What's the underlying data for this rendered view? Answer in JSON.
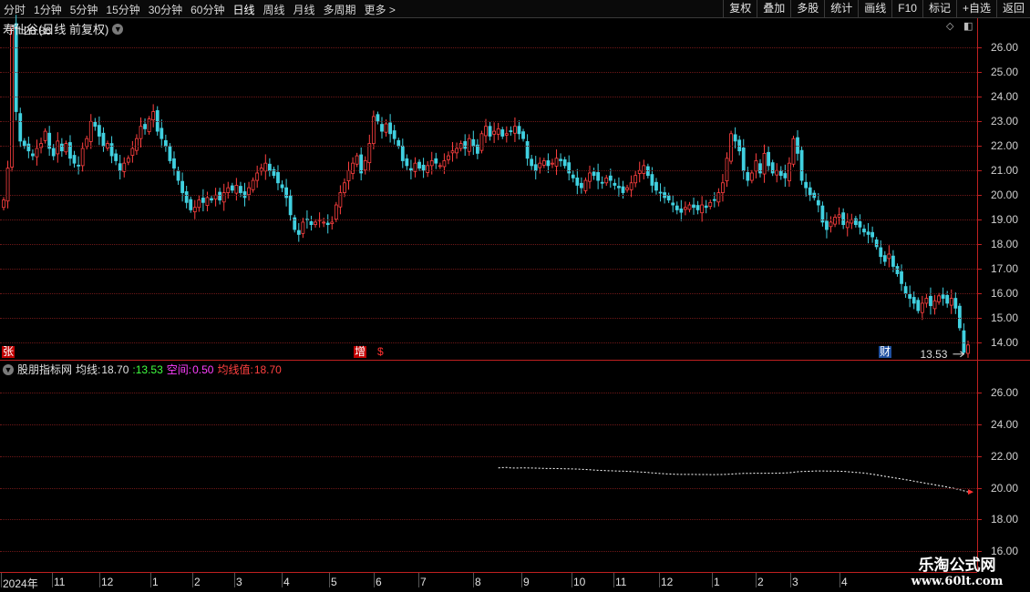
{
  "toolbar": {
    "periods": [
      "分时",
      "1分钟",
      "5分钟",
      "15分钟",
      "30分钟",
      "60分钟",
      "日线",
      "周线",
      "月线",
      "多周期",
      "更多 >"
    ],
    "active_period": "日线",
    "tools": [
      "复权",
      "叠加",
      "多股",
      "统计",
      "画线",
      "F10",
      "标记",
      "+自选",
      "返回"
    ]
  },
  "main": {
    "stock_name": "寿仙谷",
    "chart_mode": "(日线 前复权)",
    "high_label": "26.86",
    "low_label": "13.53",
    "y_ticks": [
      "26.00",
      "25.00",
      "24.00",
      "23.00",
      "22.00",
      "21.00",
      "20.00",
      "19.00",
      "18.00",
      "17.00",
      "16.00",
      "15.00",
      "14.00"
    ],
    "markers": {
      "zhang": "张",
      "zeng": "增",
      "dollar": "$",
      "cai": "财"
    },
    "colors": {
      "up": "#ff4040",
      "down": "#40d0e0",
      "grid": "#6e1818",
      "axis": "#c02020"
    }
  },
  "indicator": {
    "name": "股朋指标网",
    "label1": "均线:",
    "value1": "18.70",
    "label2": ":13.53",
    "label3": "空间:",
    "value3": "0.50",
    "label4": "均线值:",
    "value4": "18.70",
    "y_ticks": [
      "26.00",
      "24.00",
      "22.00",
      "20.00",
      "18.00",
      "16.00"
    ],
    "colors": {
      "name": "#e0e0e0",
      "value2": "#40ff40",
      "value3": "#ff40ff",
      "value4": "#ff4040"
    }
  },
  "dates": [
    "2024年",
    "11",
    "12",
    "1",
    "2",
    "3",
    "4",
    "5",
    "6",
    "7",
    "8",
    "9",
    "10",
    "11",
    "12",
    "1",
    "2",
    "3",
    "4"
  ],
  "watermark": {
    "name": "乐淘公式网",
    "url": "www.60lt.com"
  },
  "chart_data": {
    "type": "candlestick",
    "ylim": [
      13.3,
      27.2
    ],
    "closes": [
      19.8,
      21.1,
      26.86,
      23.4,
      22.2,
      22.0,
      21.8,
      21.6,
      21.9,
      22.1,
      22.6,
      21.9,
      21.6,
      22.2,
      21.8,
      22.1,
      21.5,
      21.3,
      21.2,
      21.9,
      22.3,
      23.0,
      22.8,
      22.4,
      22.0,
      22.1,
      21.6,
      21.4,
      21.0,
      21.3,
      21.5,
      21.9,
      22.3,
      22.8,
      22.7,
      23.1,
      23.4,
      22.6,
      22.3,
      22.0,
      21.4,
      21.1,
      20.6,
      20.1,
      19.7,
      19.4,
      19.5,
      19.8,
      19.7,
      19.9,
      19.8,
      20.0,
      19.8,
      20.1,
      20.3,
      20.2,
      20.4,
      20.1,
      19.9,
      20.3,
      20.6,
      20.9,
      21.1,
      21.3,
      21.0,
      20.8,
      20.5,
      20.3,
      19.9,
      19.2,
      18.6,
      18.4,
      18.9,
      19.0,
      18.8,
      18.9,
      19.0,
      18.9,
      18.8,
      18.9,
      19.6,
      20.1,
      20.5,
      21.0,
      21.3,
      21.6,
      20.9,
      21.4,
      22.1,
      23.2,
      23.0,
      22.6,
      22.9,
      22.5,
      22.3,
      22.0,
      21.4,
      21.2,
      21.0,
      21.3,
      21.1,
      21.0,
      21.2,
      21.4,
      21.3,
      21.2,
      21.4,
      21.6,
      21.8,
      21.9,
      22.1,
      21.9,
      22.3,
      22.0,
      21.7,
      22.5,
      22.8,
      22.4,
      22.6,
      22.7,
      22.4,
      22.5,
      22.6,
      22.8,
      22.5,
      22.3,
      21.5,
      21.2,
      21.0,
      21.3,
      21.4,
      21.2,
      21.3,
      21.5,
      21.4,
      21.2,
      20.9,
      20.7,
      20.4,
      20.3,
      20.6,
      20.9,
      20.8,
      20.6,
      20.5,
      20.7,
      20.6,
      20.4,
      20.3,
      20.1,
      20.3,
      20.5,
      20.8,
      21.0,
      21.2,
      20.8,
      20.4,
      20.2,
      20.1,
      19.9,
      19.8,
      19.6,
      19.4,
      19.3,
      19.5,
      19.6,
      19.5,
      19.4,
      19.6,
      19.5,
      19.7,
      19.8,
      20.1,
      20.5,
      21.5,
      22.5,
      22.2,
      21.8,
      21.0,
      20.6,
      20.9,
      21.4,
      20.9,
      21.7,
      21.2,
      20.9,
      21.0,
      20.8,
      20.7,
      21.3,
      22.3,
      21.7,
      20.6,
      20.3,
      20.0,
      19.9,
      19.6,
      18.9,
      18.6,
      18.9,
      19.1,
      19.2,
      18.8,
      18.9,
      19.0,
      18.8,
      18.7,
      18.5,
      18.4,
      18.3,
      17.9,
      17.5,
      17.3,
      17.6,
      17.1,
      16.8,
      16.4,
      16.0,
      15.8,
      15.6,
      15.3,
      15.6,
      15.8,
      15.5,
      15.7,
      15.9,
      15.8,
      15.6,
      15.8,
      15.4,
      14.6,
      13.6,
      13.9
    ]
  }
}
